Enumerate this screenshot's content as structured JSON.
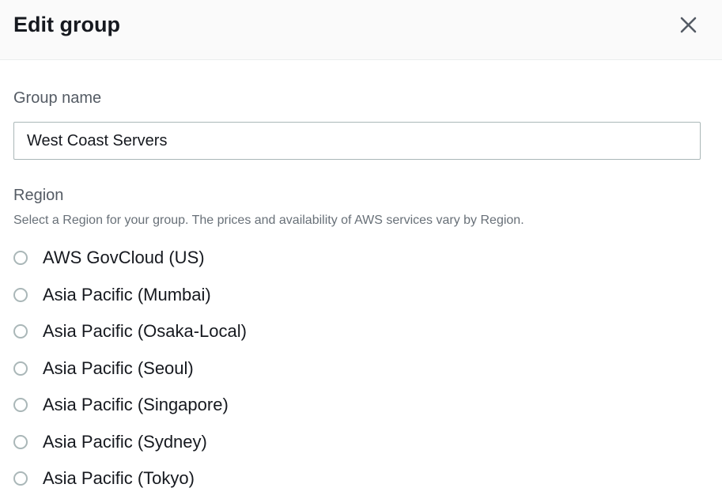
{
  "dialog": {
    "title": "Edit group",
    "close_icon": "close-icon"
  },
  "group_name": {
    "label": "Group name",
    "value": "West Coast Servers"
  },
  "region": {
    "label": "Region",
    "description": "Select a Region for your group. The prices and availability of AWS services vary by Region.",
    "options": [
      {
        "label": "AWS GovCloud (US)",
        "selected": false
      },
      {
        "label": "Asia Pacific (Mumbai)",
        "selected": false
      },
      {
        "label": "Asia Pacific (Osaka-Local)",
        "selected": false
      },
      {
        "label": "Asia Pacific (Seoul)",
        "selected": false
      },
      {
        "label": "Asia Pacific (Singapore)",
        "selected": false
      },
      {
        "label": "Asia Pacific (Sydney)",
        "selected": false
      },
      {
        "label": "Asia Pacific (Tokyo)",
        "selected": false
      }
    ]
  },
  "colors": {
    "text_primary": "#16191f",
    "text_secondary": "#545b64",
    "border": "#aab7b8",
    "header_bg": "#fafafa"
  }
}
